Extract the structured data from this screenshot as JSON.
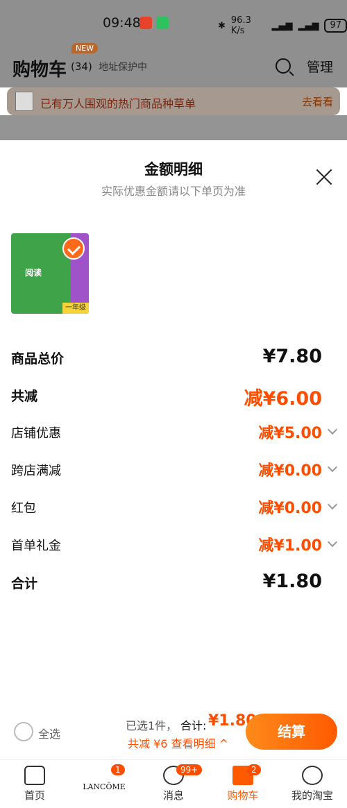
{
  "status": {
    "time": "09:48",
    "battery": "97",
    "net_speed": "96.3 K/s"
  },
  "header": {
    "title": "购物车",
    "count": "(34)",
    "new_badge": "NEW",
    "address": "地址保护中",
    "manage": "管理"
  },
  "banner": {
    "text": "已有万人围观的热门商品种草单",
    "link": "去看看"
  },
  "sheet": {
    "title": "金额明细",
    "subtitle": "实际优惠金额请以下单页为准",
    "product": {
      "cover_text": "阅读",
      "grade": "一年级"
    },
    "rows": [
      {
        "label": "商品总价",
        "value": "¥7.80"
      },
      {
        "label": "共减",
        "value": "减¥6.00"
      },
      {
        "label": "店铺优惠",
        "value": "减¥5.00"
      },
      {
        "label": "跨店满减",
        "value": "减¥0.00"
      },
      {
        "label": "红包",
        "value": "减¥0.00"
      },
      {
        "label": "首单礼金",
        "value": "减¥1.00"
      },
      {
        "label": "合计",
        "value": "¥1.80"
      }
    ]
  },
  "footer": {
    "select_all": "全选",
    "selected": "已选1件，",
    "total_label": "合计:",
    "total_value": "¥1.80",
    "reduce_detail": "共减 ¥6  查看明细 ^",
    "checkout": "结算"
  },
  "tabs": [
    {
      "label": "首页"
    },
    {
      "label": "LANCÔME",
      "badge": "1"
    },
    {
      "label": "消息",
      "badge": "99+"
    },
    {
      "label": "购物车",
      "badge": "2"
    },
    {
      "label": "我的淘宝"
    }
  ],
  "colors": {
    "accent": "#ff5a00",
    "discount": "#ff4d00"
  }
}
